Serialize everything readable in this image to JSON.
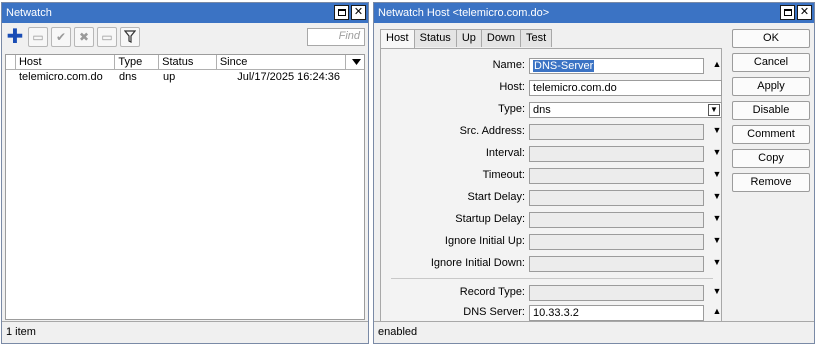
{
  "left_window": {
    "title": "Netwatch",
    "find_placeholder": "Find",
    "columns": [
      "Host",
      "Type",
      "Status",
      "Since"
    ],
    "rows": [
      {
        "host": "telemicro.com.do",
        "type": "dns",
        "status": "up",
        "since": "Jul/17/2025 16:24:36"
      }
    ],
    "status_text": "1 item"
  },
  "right_window": {
    "title": "Netwatch Host <telemicro.com.do>",
    "tabs": [
      "Host",
      "Status",
      "Up",
      "Down",
      "Test"
    ],
    "fields": {
      "name": {
        "label": "Name:",
        "value": "DNS-Server"
      },
      "host": {
        "label": "Host:",
        "value": "telemicro.com.do"
      },
      "type": {
        "label": "Type:",
        "value": "dns"
      },
      "src_address": {
        "label": "Src. Address:",
        "value": ""
      },
      "interval": {
        "label": "Interval:",
        "value": ""
      },
      "timeout": {
        "label": "Timeout:",
        "value": ""
      },
      "start_delay": {
        "label": "Start Delay:",
        "value": ""
      },
      "startup_delay": {
        "label": "Startup Delay:",
        "value": ""
      },
      "ignore_initial_up": {
        "label": "Ignore Initial Up:",
        "value": ""
      },
      "ignore_initial_down": {
        "label": "Ignore Initial Down:",
        "value": ""
      },
      "record_type": {
        "label": "Record Type:",
        "value": ""
      },
      "dns_server": {
        "label": "DNS Server:",
        "value": "10.33.3.2"
      }
    },
    "buttons": [
      "OK",
      "Cancel",
      "Apply",
      "Disable",
      "Comment",
      "Copy",
      "Remove"
    ],
    "status_text": "enabled"
  },
  "icons": {
    "add": "plus-icon",
    "remove": "minus-icon",
    "enable": "check-icon",
    "disable": "cross-icon",
    "comment": "note-icon",
    "filter": "filter-icon",
    "restore": "restore-icon",
    "close": "close-icon"
  },
  "colors": {
    "titlebar": "#3b73c4",
    "selection": "#3b73c4",
    "add_icon": "#1a4db5"
  }
}
